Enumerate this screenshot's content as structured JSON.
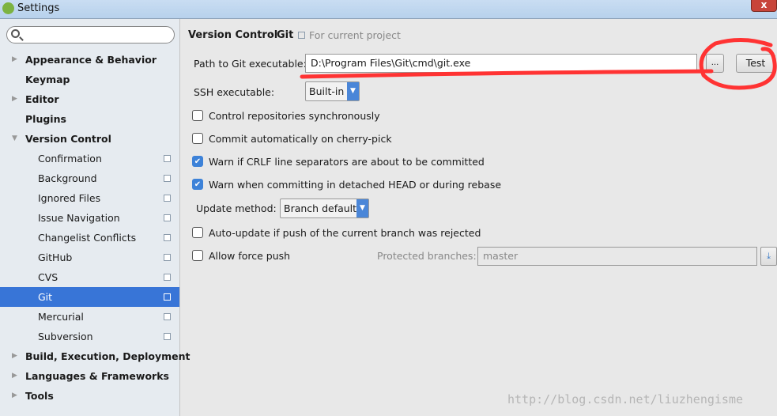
{
  "window": {
    "title": "Settings",
    "close": "x"
  },
  "search": {
    "placeholder": ""
  },
  "sidebar": {
    "items": [
      {
        "label": "Appearance & Behavior",
        "level": "top",
        "expandable": true
      },
      {
        "label": "Keymap",
        "level": "top",
        "expandable": false
      },
      {
        "label": "Editor",
        "level": "top",
        "expandable": true
      },
      {
        "label": "Plugins",
        "level": "top",
        "expandable": false
      },
      {
        "label": "Version Control",
        "level": "top",
        "expandable": true,
        "expanded": true
      },
      {
        "label": "Confirmation",
        "level": "sub",
        "project": true
      },
      {
        "label": "Background",
        "level": "sub",
        "project": true
      },
      {
        "label": "Ignored Files",
        "level": "sub",
        "project": true
      },
      {
        "label": "Issue Navigation",
        "level": "sub",
        "project": true
      },
      {
        "label": "Changelist Conflicts",
        "level": "sub",
        "project": true
      },
      {
        "label": "GitHub",
        "level": "sub",
        "project": true
      },
      {
        "label": "CVS",
        "level": "sub",
        "project": true
      },
      {
        "label": "Git",
        "level": "sub",
        "project": true,
        "selected": true
      },
      {
        "label": "Mercurial",
        "level": "sub",
        "project": true
      },
      {
        "label": "Subversion",
        "level": "sub",
        "project": true
      },
      {
        "label": "Build, Execution, Deployment",
        "level": "top",
        "expandable": true
      },
      {
        "label": "Languages & Frameworks",
        "level": "top",
        "expandable": true
      },
      {
        "label": "Tools",
        "level": "top",
        "expandable": true
      }
    ]
  },
  "breadcrumb": {
    "parent": "Version Control",
    "sep": "›",
    "current": "Git",
    "scope": "For current project"
  },
  "git": {
    "path_label": "Path to Git executable:",
    "path_value": "D:\\Program Files\\Git\\cmd\\git.exe",
    "browse": "...",
    "test": "Test",
    "ssh_label": "SSH executable:",
    "ssh_value": "Built-in",
    "checks": [
      {
        "label": "Control repositories synchronously",
        "checked": false
      },
      {
        "label": "Commit automatically on cherry-pick",
        "checked": false
      },
      {
        "label": "Warn if CRLF line separators are about to be committed",
        "checked": true
      },
      {
        "label": "Warn when committing in detached HEAD or during rebase",
        "checked": true
      }
    ],
    "update_label": "Update method:",
    "update_value": "Branch default",
    "autoupdate": {
      "label": "Auto-update if push of the current branch was rejected",
      "checked": false
    },
    "forcepush": {
      "label": "Allow force push",
      "checked": false
    },
    "protected_label": "Protected branches:",
    "protected_value": "master"
  },
  "watermark": "http://blog.csdn.net/liuzhengisme",
  "colors": {
    "selection": "#3875d7",
    "annotation": "#ff3333"
  }
}
